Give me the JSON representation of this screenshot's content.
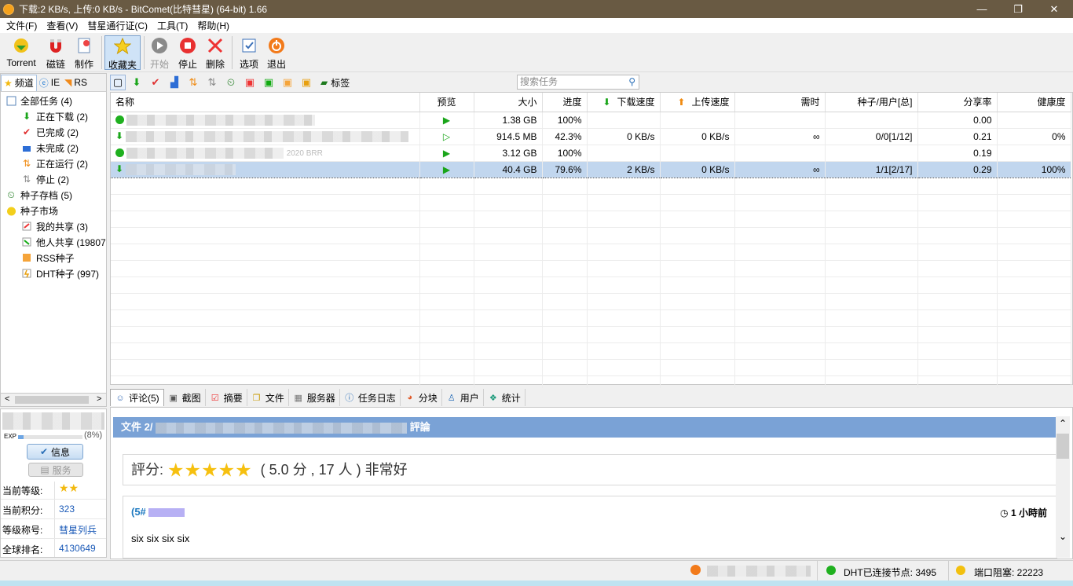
{
  "titlebar": {
    "title": "下载:2 KB/s, 上传:0 KB/s - BitComet(比特彗星) (64-bit) 1.66",
    "minimize": "—",
    "restore": "❐",
    "close": "✕"
  },
  "menu": [
    "文件(F)",
    "查看(V)",
    "彗星通行证(C)",
    "工具(T)",
    "帮助(H)"
  ],
  "toolbar": {
    "torrent": "Torrent",
    "magnet": "磁链",
    "make": "制作",
    "favorites": "收藏夹",
    "start": "开始",
    "stop": "停止",
    "delete": "删除",
    "options": "选项",
    "exit": "退出"
  },
  "left_tabs": {
    "channel": "频道",
    "ie": "IE",
    "rss": "RS"
  },
  "tree": {
    "all_tasks": "全部任务 (4)",
    "downloading": "正在下载 (2)",
    "completed": "已完成 (2)",
    "incomplete": "未完成 (2)",
    "running": "正在运行 (2)",
    "stopped": "停止 (2)",
    "torrent_archive": "种子存档 (5)",
    "torrent_market": "种子市场",
    "my_shares": "我的共享 (3)",
    "others_shares": "他人共享 (19807",
    "rss_seeds": "RSS种子",
    "dht_seeds": "DHT种子 (997)"
  },
  "user": {
    "exp_label": "EXP",
    "exp_percent": "(8%)",
    "exp_fraction": 0.08,
    "info_button": "信息",
    "service_button": "服务",
    "level_label": "当前等级:",
    "level_stars": "★★",
    "points_label": "当前积分:",
    "points": "323",
    "title_label": "等级称号:",
    "title": "彗星列兵",
    "rank_label": "全球排名:",
    "rank": "4130649"
  },
  "task_toolbar": {
    "tag": "标签",
    "search_placeholder": "搜索任务"
  },
  "columns": {
    "name": "名称",
    "preview": "预览",
    "size": "大小",
    "progress": "进度",
    "down_speed": "下载速度",
    "up_speed": "上传速度",
    "eta": "需时",
    "seeds": "种子/用户[总]",
    "ratio": "分享率",
    "health": "健康度"
  },
  "tasks": [
    {
      "size": "1.38 GB",
      "progress": "100%",
      "down": "",
      "up": "",
      "eta": "",
      "seeds": "",
      "ratio": "0.00",
      "health": ""
    },
    {
      "size": "914.5 MB",
      "progress": "42.3%",
      "down": "0 KB/s",
      "up": "0 KB/s",
      "eta": "∞",
      "seeds": "0/0[1/12]",
      "ratio": "0.21",
      "health": "0%"
    },
    {
      "size": "3.12 GB",
      "progress": "100%",
      "down": "",
      "up": "",
      "eta": "",
      "seeds": "",
      "ratio": "0.19",
      "health": ""
    },
    {
      "size": "40.4 GB",
      "progress": "79.6%",
      "down": "2 KB/s",
      "up": "0 KB/s",
      "eta": "∞",
      "seeds": "1/1[2/17]",
      "ratio": "0.29",
      "health": "100%"
    }
  ],
  "task3_name_fragment": "2020 BRR",
  "bottom_tabs": [
    "评论(5)",
    "截图",
    "摘要",
    "文件",
    "服务器",
    "任务日志",
    "分块",
    "用户",
    "统计"
  ],
  "comments": {
    "header_prefix": "文件 2/",
    "header_suffix": "評論",
    "rating_label": "評分:",
    "rating_stars": 5,
    "rating_text": "( 5.0 分 , 17 人 ) 非常好",
    "comment_id": "(5#",
    "comment_time": "1 小時前",
    "comment_text": "six six six six"
  },
  "status": {
    "dht": "DHT已连接节点: 3495",
    "port": "端口阻塞: 22223"
  },
  "colors": {
    "titlebar": "#695a43",
    "selected_row": "#c1d6ee",
    "comment_header": "#7aa2d6",
    "green_status": "#1fb01f"
  }
}
